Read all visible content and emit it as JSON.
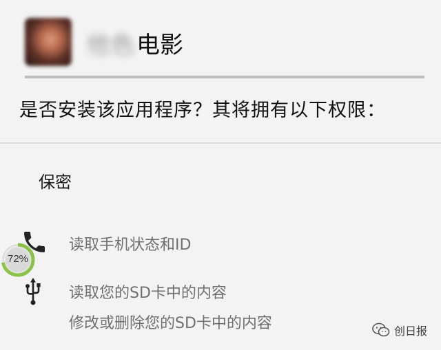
{
  "app": {
    "name_blurred": "他色",
    "name_visible": "电影"
  },
  "dialog": {
    "question": "是否安装该应用程序？其将拥有以下权限："
  },
  "permissions": {
    "section_title": "保密",
    "items": [
      {
        "icon": "phone-icon",
        "text": "读取手机状态和ID"
      },
      {
        "icon": "usb-icon",
        "text": "读取您的SD卡中的内容"
      },
      {
        "icon": "",
        "text": "修改或删除您的SD卡中的内容"
      }
    ]
  },
  "progress_badge": {
    "label": "72%",
    "value": 0.72,
    "color": "#8bc34a"
  },
  "watermark": {
    "text": "创日报",
    "icon": "wechat-icon"
  },
  "colors": {
    "background": "#f3f3f3",
    "rule": "#bdbdbd",
    "secondary_text": "#6f6f6f"
  }
}
